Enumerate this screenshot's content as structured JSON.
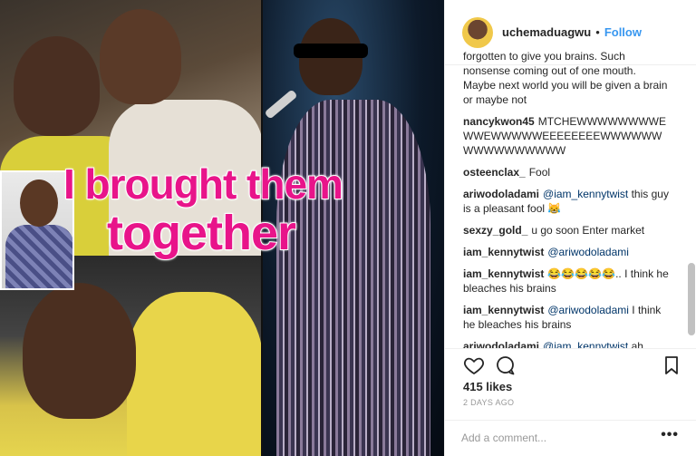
{
  "post": {
    "image_caption": [
      "I brought them",
      "together"
    ]
  },
  "header": {
    "username": "uchemaduagwu",
    "separator": "•",
    "follow_label": "Follow"
  },
  "comments": {
    "partial_text": "forgotten to give you brains. Such nonsense coming out of one mouth. Maybe next world you will be given a brain or maybe not",
    "items": [
      {
        "user": "nancykwon45",
        "text": "MTCHEWWWWWWWWEWWEWWWWWEEEEEEEEWWWWWWWWWWWWWWWW"
      },
      {
        "user": "osteenclax_",
        "text": "Fool"
      },
      {
        "user": "ariwodoladami",
        "mention": "@iam_kennytwist",
        "text": "this guy is a pleasant fool 😹"
      },
      {
        "user": "sexzy_gold_",
        "text": "u go soon Enter market"
      },
      {
        "user": "iam_kennytwist",
        "mention": "@ariwodoladami",
        "text": ""
      },
      {
        "user": "iam_kennytwist",
        "text": "😂😂😂😂😂.. I think he bleaches his brains"
      },
      {
        "user": "iam_kennytwist",
        "mention": "@ariwodoladami",
        "text": "I think he bleaches his brains"
      },
      {
        "user": "ariwodoladami",
        "mention": "@iam_kennytwist",
        "text": "ah nooo! That's too harsh. Don't be silly😹😹"
      }
    ]
  },
  "actions": {
    "likes": "415 likes",
    "time": "2 DAYS AGO",
    "add_comment_placeholder": "Add a comment...",
    "more": "•••"
  },
  "icons": {
    "like": "heart-icon",
    "comment": "comment-bubble-icon",
    "save": "bookmark-icon"
  },
  "colors": {
    "follow": "#3897f0",
    "caption": "#e8148a"
  }
}
